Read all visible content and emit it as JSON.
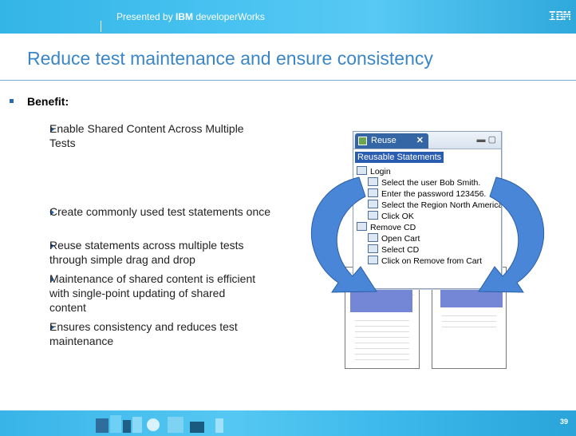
{
  "header": {
    "presented_prefix": "Presented by ",
    "presented_brand": "IBM",
    "presented_suffix": " developerWorks",
    "logo": "IBM"
  },
  "title": "Reduce test maintenance and ensure consistency",
  "benefit_label": "Benefit:",
  "items": [
    "Enable Shared Content Across Multiple Tests",
    "Create commonly used test statements once",
    "Reuse statements across multiple tests through simple drag and drop",
    "Maintenance of shared content is efficient with single-point updating of shared content",
    "Ensures consistency and reduces test maintenance"
  ],
  "illustration": {
    "tab_label": "Reuse",
    "tab_close": "✕",
    "window_controls": "▬ ▢",
    "panel_title": "Reusable Statements",
    "tree": [
      {
        "label": "Login",
        "level": 0
      },
      {
        "label": "Select the user Bob Smith.",
        "level": 1
      },
      {
        "label": "Enter the password 123456.",
        "level": 1
      },
      {
        "label": "Select the Region North America",
        "level": 1
      },
      {
        "label": "Click OK",
        "level": 1
      },
      {
        "label": "Remove CD",
        "level": 0
      },
      {
        "label": "Open Cart",
        "level": 1
      },
      {
        "label": "Select CD",
        "level": 1
      },
      {
        "label": "Click on Remove from Cart",
        "level": 1
      }
    ],
    "arrow_color": "#4a86d8"
  },
  "footer": {
    "page_number": "39"
  }
}
